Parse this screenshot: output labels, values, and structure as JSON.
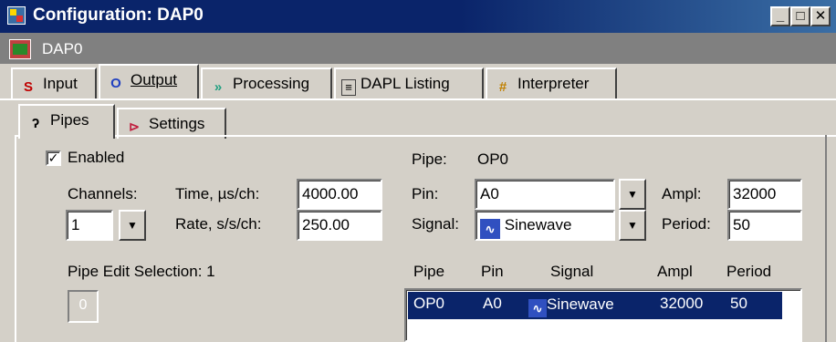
{
  "window": {
    "title": "Configuration: DAP0",
    "minimize_glyph": "_",
    "maximize_glyph": "□",
    "close_glyph": "✕"
  },
  "subheader": {
    "title": "DAP0"
  },
  "main_tabs": [
    {
      "label": "Input",
      "icon": "input-icon",
      "icon_text": "S",
      "active": false
    },
    {
      "label": "Output",
      "icon": "output-icon",
      "icon_text": "O",
      "active": true
    },
    {
      "label": "Processing",
      "icon": "processing-icon",
      "icon_text": "»",
      "active": false
    },
    {
      "label": "DAPL Listing",
      "icon": "listing-icon",
      "icon_text": "≡",
      "active": false
    },
    {
      "label": "Interpreter",
      "icon": "interpreter-icon",
      "icon_text": "#",
      "active": false
    }
  ],
  "sub_tabs": [
    {
      "label": "Pipes",
      "icon": "pipe-icon",
      "icon_text": "ʔ",
      "active": true
    },
    {
      "label": "Settings",
      "icon": "settings-icon",
      "icon_text": "⊳",
      "active": false
    }
  ],
  "form": {
    "enabled_label": "Enabled",
    "enabled_checked": true,
    "enabled_mark": "✓",
    "channels_label": "Channels:",
    "channels_value": "1",
    "time_label": "Time, µs/ch:",
    "time_value": "4000.00",
    "rate_label": "Rate, s/s/ch:",
    "rate_value": "250.00",
    "pipe_label": "Pipe:",
    "pipe_value": "OP0",
    "pin_label": "Pin:",
    "pin_value": "A0",
    "signal_label": "Signal:",
    "signal_value": "Sinewave",
    "ampl_label": "Ampl:",
    "ampl_value": "32000",
    "period_label": "Period:",
    "period_value": "50",
    "pipe_edit_label": "Pipe Edit Selection: 1",
    "pipe_edit_value": "0",
    "dropdown_glyph": "▼"
  },
  "pipe_table": {
    "headers": [
      "Pipe",
      "Pin",
      "Signal",
      "Ampl",
      "Period"
    ],
    "rows": [
      {
        "pipe": "OP0",
        "pin": "A0",
        "signal": "Sinewave",
        "ampl": "32000",
        "period": "50",
        "selected": true
      }
    ]
  },
  "colors": {
    "title_bar": "#0a246a",
    "face": "#d4d0c8",
    "selection": "#0a246a",
    "signal_icon": "#3050c0"
  }
}
